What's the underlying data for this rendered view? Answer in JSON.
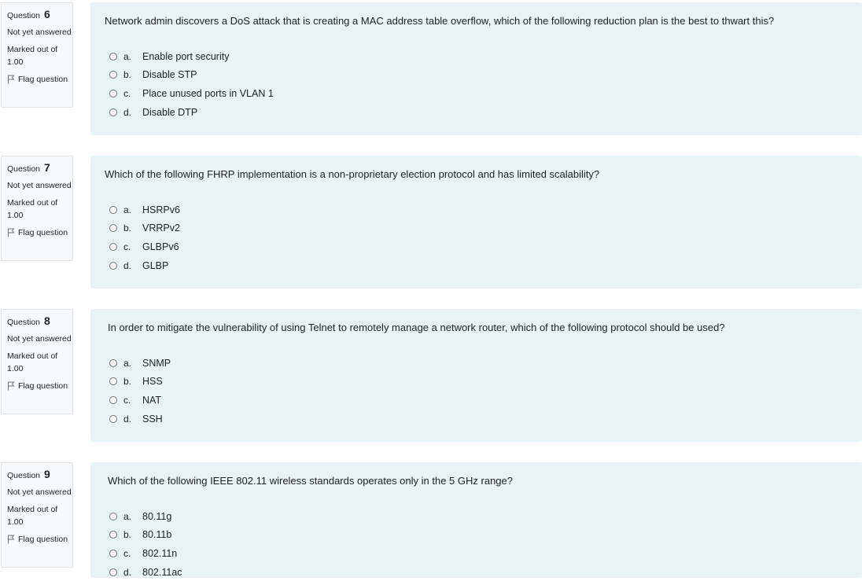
{
  "questions": [
    {
      "label": "Question",
      "number": "6",
      "state": "Not yet answered",
      "grade": "Marked out of 1.00",
      "flag_label": "Flag question",
      "text": "Network admin discovers a DoS attack that is creating a MAC address table overflow, which of the following reduction plan is the best to thwart this?",
      "answers": [
        {
          "letter": "a.",
          "text": "Enable port security"
        },
        {
          "letter": "b.",
          "text": "Disable STP"
        },
        {
          "letter": "c.",
          "text": "Place unused ports in VLAN 1"
        },
        {
          "letter": "d.",
          "text": "Disable DTP"
        }
      ]
    },
    {
      "label": "Question",
      "number": "7",
      "state": "Not yet answered",
      "grade": "Marked out of 1.00",
      "flag_label": "Flag question",
      "text": "Which of the following FHRP implementation is a non-proprietary election protocol and has limited scalability?",
      "answers": [
        {
          "letter": "a.",
          "text": "HSRPv6"
        },
        {
          "letter": "b.",
          "text": "VRRPv2"
        },
        {
          "letter": "c.",
          "text": "GLBPv6"
        },
        {
          "letter": "d.",
          "text": "GLBP"
        }
      ]
    },
    {
      "label": "Question",
      "number": "8",
      "state": "Not yet answered",
      "grade": "Marked out of 1.00",
      "flag_label": "Flag question",
      "text": "In order to mitigate the vulnerability of using Telnet to remotely manage a network router, which of the following protocol should be used?",
      "answers": [
        {
          "letter": "a.",
          "text": "SNMP"
        },
        {
          "letter": "b.",
          "text": "HSS"
        },
        {
          "letter": "c.",
          "text": "NAT"
        },
        {
          "letter": "d.",
          "text": "SSH"
        }
      ]
    },
    {
      "label": "Question",
      "number": "9",
      "state": "Not yet answered",
      "grade": "Marked out of 1.00",
      "flag_label": "Flag question",
      "text": "Which of the following IEEE 802.11 wireless standards operates only in the 5 GHz range?",
      "answers": [
        {
          "letter": "a.",
          "text": "80.11g"
        },
        {
          "letter": "b.",
          "text": "80.11b"
        },
        {
          "letter": "c.",
          "text": "802.11n"
        },
        {
          "letter": "d.",
          "text": "802.11ac"
        }
      ]
    }
  ],
  "icons": {
    "flag": "flag-icon",
    "radio": "radio-unchecked-icon"
  }
}
